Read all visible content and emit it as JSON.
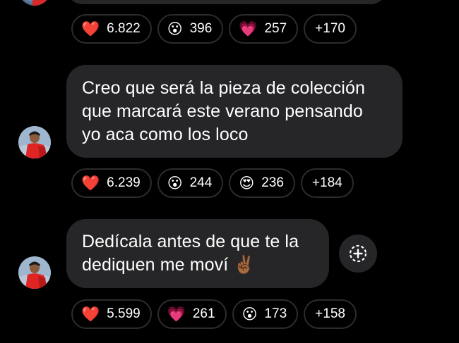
{
  "messages": [
    {
      "reactions": [
        {
          "emoji": "❤️",
          "icon": "red-heart-icon",
          "count": "6.822"
        },
        {
          "emoji": "😮",
          "icon": "surprised-face-icon",
          "count": "396"
        },
        {
          "emoji": "💗",
          "icon": "pink-heart-icon",
          "count": "257"
        },
        {
          "more": "+170"
        }
      ]
    },
    {
      "lines": [
        "Creo que será la pieza de colección",
        "que marcará este verano pensando",
        "yo aca como los loco"
      ],
      "reactions": [
        {
          "emoji": "❤️",
          "icon": "red-heart-icon",
          "count": "6.239"
        },
        {
          "emoji": "😮",
          "icon": "surprised-face-icon",
          "count": "244"
        },
        {
          "emoji": "😍",
          "icon": "heart-eyes-face-icon",
          "count": "236"
        },
        {
          "more": "+184"
        }
      ]
    },
    {
      "lines": [
        "Dedícala antes de que te la",
        "dediquen me moví ✌🏾"
      ],
      "reactions": [
        {
          "emoji": "❤️",
          "icon": "red-heart-icon",
          "count": "5.599"
        },
        {
          "emoji": "💗",
          "icon": "pink-heart-icon",
          "count": "261"
        },
        {
          "emoji": "😮",
          "icon": "surprised-face-icon",
          "count": "173"
        },
        {
          "more": "+158"
        }
      ]
    }
  ],
  "colors": {
    "background": "#000000",
    "bubble": "#262628",
    "pill_border": "#2c2c2e",
    "text": "#ffffff"
  }
}
